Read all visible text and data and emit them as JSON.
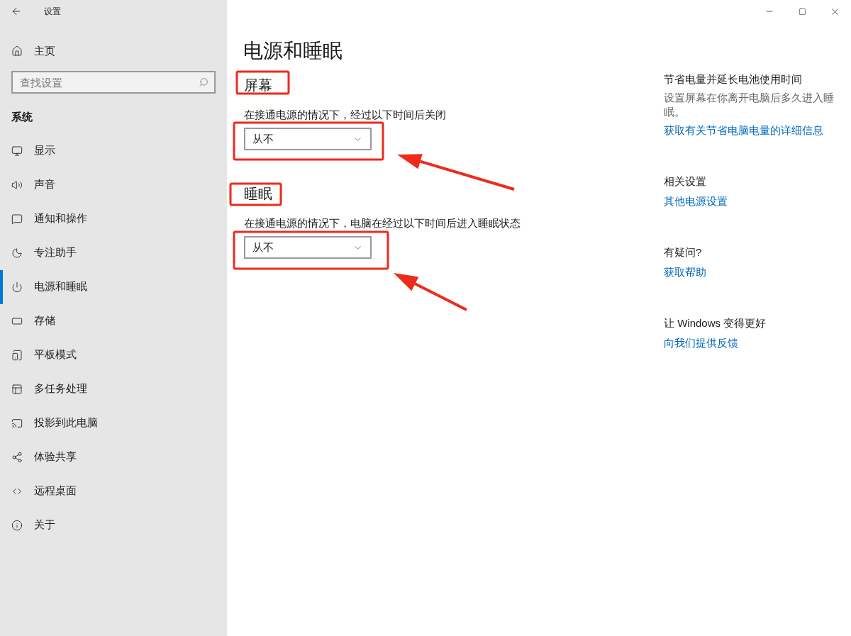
{
  "window": {
    "title": "设置"
  },
  "sidebar": {
    "home": "主页",
    "search": {
      "placeholder": "查找设置"
    },
    "section": "系统",
    "items": [
      {
        "label": "显示",
        "selected": false
      },
      {
        "label": "声音",
        "selected": false
      },
      {
        "label": "通知和操作",
        "selected": false
      },
      {
        "label": "专注助手",
        "selected": false
      },
      {
        "label": "电源和睡眠",
        "selected": true
      },
      {
        "label": "存储",
        "selected": false
      },
      {
        "label": "平板模式",
        "selected": false
      },
      {
        "label": "多任务处理",
        "selected": false
      },
      {
        "label": "投影到此电脑",
        "selected": false
      },
      {
        "label": "体验共享",
        "selected": false
      },
      {
        "label": "远程桌面",
        "selected": false
      },
      {
        "label": "关于",
        "selected": false
      }
    ]
  },
  "main": {
    "title": "电源和睡眠",
    "sections": [
      {
        "heading": "屏幕",
        "description": "在接通电源的情况下，经过以下时间后关闭",
        "value": "从不"
      },
      {
        "heading": "睡眠",
        "description": "在接通电源的情况下，电脑在经过以下时间后进入睡眠状态",
        "value": "从不"
      }
    ]
  },
  "aside": [
    {
      "heading": "节省电量并延长电池使用时间",
      "text": "设置屏幕在你离开电脑后多久进入睡眠。",
      "link": "获取有关节省电脑电量的详细信息"
    },
    {
      "heading": "相关设置",
      "link": "其他电源设置"
    },
    {
      "heading": "有疑问?",
      "link": "获取帮助"
    },
    {
      "heading": "让 Windows 变得更好",
      "link": "向我们提供反馈"
    }
  ]
}
